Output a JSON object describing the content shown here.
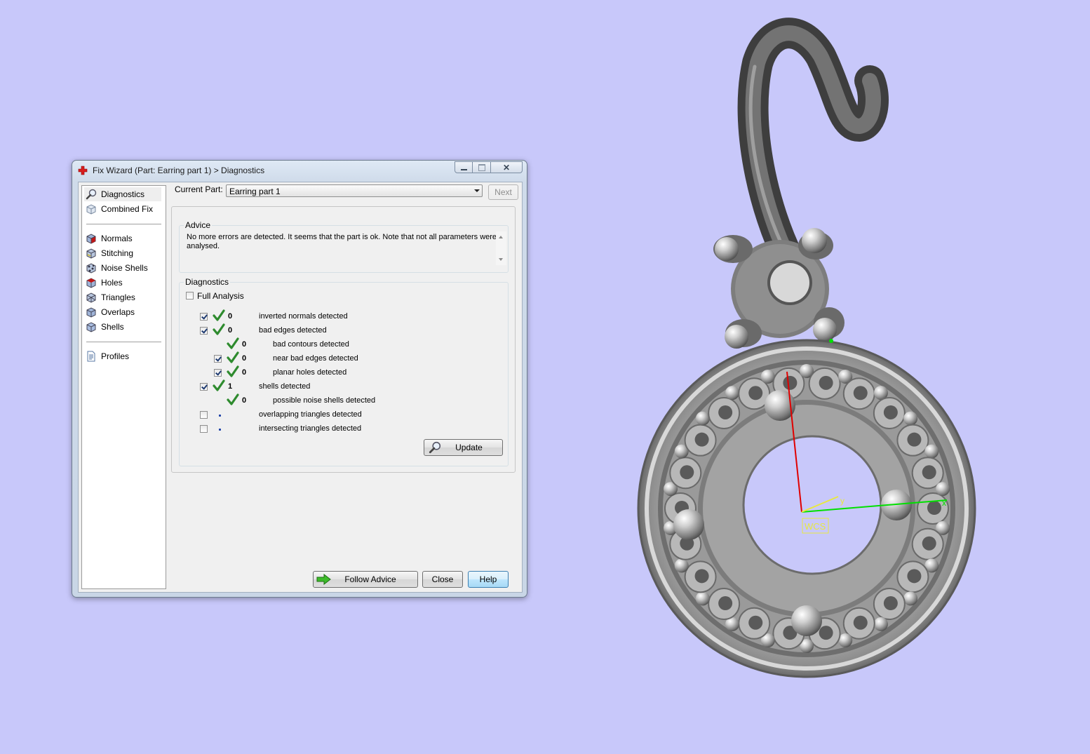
{
  "window": {
    "title": "Fix Wizard (Part: Earring part 1) > Diagnostics"
  },
  "sidebar": {
    "items": [
      {
        "label": "Diagnostics",
        "icon": "magnifier-icon",
        "active": true
      },
      {
        "label": "Combined Fix",
        "icon": "cube-outline-icon"
      },
      {
        "label": "Normals",
        "icon": "normals-cube-icon"
      },
      {
        "label": "Stitching",
        "icon": "stitching-cube-icon"
      },
      {
        "label": "Noise Shells",
        "icon": "noise-shells-icon"
      },
      {
        "label": "Holes",
        "icon": "holes-cube-icon"
      },
      {
        "label": "Triangles",
        "icon": "triangles-cube-icon"
      },
      {
        "label": "Overlaps",
        "icon": "overlaps-cube-icon"
      },
      {
        "label": "Shells",
        "icon": "shells-cube-icon"
      },
      {
        "label": "Profiles",
        "icon": "document-icon"
      }
    ]
  },
  "current_part": {
    "label": "Current Part:",
    "value": "Earring part 1",
    "next_label": "Next"
  },
  "advice": {
    "title": "Advice",
    "text": "No more errors are detected. It seems that the part is ok. Note that not all parameters were analysed."
  },
  "diagnostics": {
    "title": "Diagnostics",
    "full_analysis_label": "Full Analysis",
    "rows": [
      {
        "checked": true,
        "status": "ok",
        "count": "0",
        "text": "inverted normals detected",
        "indent": 0
      },
      {
        "checked": true,
        "status": "ok",
        "count": "0",
        "text": "bad edges detected",
        "indent": 0
      },
      {
        "checked": null,
        "status": "ok",
        "count": "0",
        "text": "bad contours detected",
        "indent": 1
      },
      {
        "checked": true,
        "status": "ok",
        "count": "0",
        "text": "near bad edges detected",
        "indent": 1
      },
      {
        "checked": true,
        "status": "ok",
        "count": "0",
        "text": "planar holes detected",
        "indent": 1
      },
      {
        "checked": true,
        "status": "ok",
        "count": "1",
        "text": "shells detected",
        "indent": 0
      },
      {
        "checked": null,
        "status": "ok",
        "count": "0",
        "text": "possible noise shells detected",
        "indent": 1
      },
      {
        "checked": false,
        "status": "pending",
        "count": "",
        "text": "overlapping triangles detected",
        "indent": 0
      },
      {
        "checked": false,
        "status": "pending",
        "count": "",
        "text": "intersecting triangles detected",
        "indent": 0
      }
    ],
    "update_label": "Update"
  },
  "buttons": {
    "follow_advice": "Follow Advice",
    "close": "Close",
    "help": "Help"
  },
  "viewport": {
    "background": "#c8c8fa",
    "axis_y_label": "y",
    "axis_x_label": "x",
    "wcs_label": "WCS"
  },
  "colors": {
    "check_green": "#2e8b2e",
    "hot_button": "#bee6fd",
    "axis_red": "#e00000",
    "axis_green": "#00e000",
    "axis_yellow": "#e8e840"
  }
}
